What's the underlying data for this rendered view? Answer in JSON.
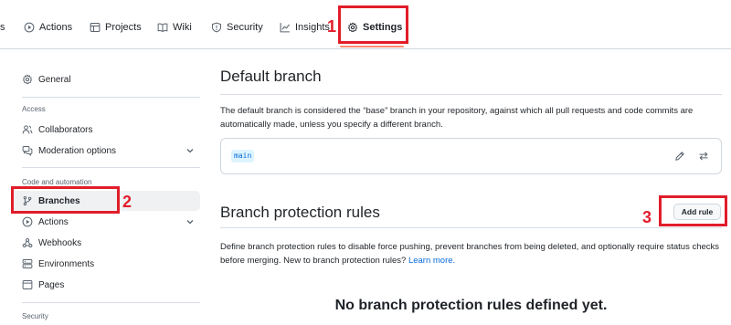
{
  "nav": {
    "tabs": [
      {
        "label": "Actions",
        "icon": "play-icon"
      },
      {
        "label": "Projects",
        "icon": "table-icon"
      },
      {
        "label": "Wiki",
        "icon": "book-icon"
      },
      {
        "label": "Security",
        "icon": "shield-icon"
      },
      {
        "label": "Insights",
        "icon": "graph-icon"
      },
      {
        "label": "Settings",
        "icon": "gear-icon",
        "selected": true
      }
    ]
  },
  "sidebar": {
    "general": "General",
    "access_heading": "Access",
    "collaborators": "Collaborators",
    "moderation": "Moderation options",
    "code_heading": "Code and automation",
    "branches": "Branches",
    "actions": "Actions",
    "webhooks": "Webhooks",
    "environments": "Environments",
    "pages": "Pages",
    "security_heading": "Security"
  },
  "default_branch": {
    "title": "Default branch",
    "description": "The default branch is considered the “base” branch in your repository, against which all pull requests and code commits are automatically made, unless you specify a different branch.",
    "branch_name": "main"
  },
  "protection": {
    "title": "Branch protection rules",
    "add_rule": "Add rule",
    "description": "Define branch protection rules to disable force pushing, prevent branches from being deleted, and optionally require status checks before merging. New to branch protection rules?",
    "learn_more": "Learn more.",
    "empty_title": "No branch protection rules defined yet."
  },
  "annotations": {
    "one": "1",
    "two": "2",
    "three": "3"
  },
  "colors": {
    "annotation": "#e11d2a",
    "accent": "#0969da",
    "tab_underline": "#fd8c73"
  }
}
